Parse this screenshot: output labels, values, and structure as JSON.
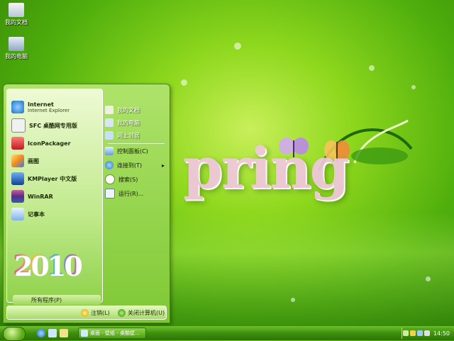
{
  "desktop": {
    "icons": [
      {
        "label": "我的文档",
        "icon": "my-documents-icon"
      },
      {
        "label": "我的电脑",
        "icon": "my-computer-icon"
      }
    ],
    "wallpaper_text": "pring"
  },
  "start_menu": {
    "pinned": [
      {
        "title": "Internet",
        "subtitle": "Internet Explorer",
        "icon": "internet-explorer-icon"
      },
      {
        "title": "SFC 桌酷网专用版",
        "icon": "sfc-icon"
      },
      {
        "title": "IconPackager",
        "icon": "iconpackager-icon"
      },
      {
        "title": "画图",
        "icon": "paint-icon"
      },
      {
        "title": "KMPlayer 中文版",
        "icon": "kmplayer-icon"
      },
      {
        "title": "WinRAR",
        "icon": "winrar-icon"
      },
      {
        "title": "记事本",
        "icon": "notepad-icon"
      }
    ],
    "year_art": "2010",
    "all_programs": "所有程序(P)",
    "places": [
      {
        "label": "我的文档",
        "icon": "documents-icon"
      },
      {
        "label": "我的电脑",
        "icon": "computer-icon"
      },
      {
        "label": "网上邻居",
        "icon": "network-icon"
      },
      {
        "label": "控制面板(C)",
        "icon": "control-panel-icon"
      },
      {
        "label": "连接到(T)",
        "icon": "connect-icon",
        "arrow": "▸"
      },
      {
        "label": "搜索(S)",
        "icon": "search-icon"
      },
      {
        "label": "运行(R)...",
        "icon": "run-icon"
      }
    ],
    "logoff": "注销(L)",
    "shutdown": "关闭计算机(U)"
  },
  "taskbar": {
    "task_label": "桌面 - 壁纸 - 桌酷壁...",
    "clock": "14:50"
  },
  "colors": {
    "accent": "#7fc835",
    "taskbar": "#3d8f0e",
    "text_dark": "#1b2a08"
  }
}
